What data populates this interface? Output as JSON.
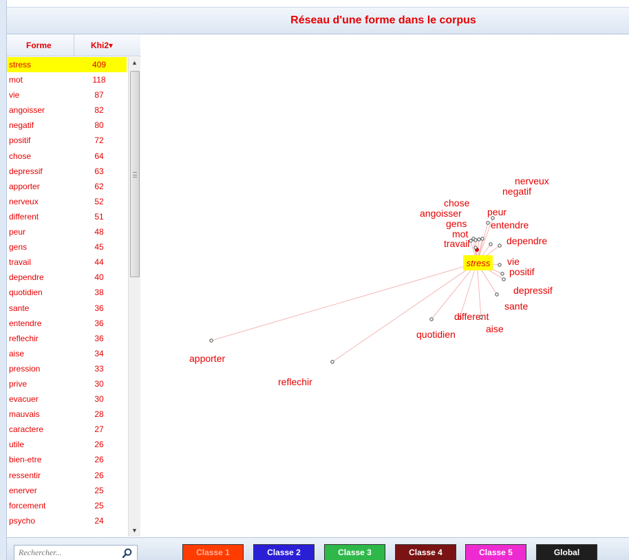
{
  "title": "Réseau d'une forme dans le corpus",
  "list": {
    "col_forme": "Forme",
    "col_khi": "Khi2",
    "sort_arrow": "▾",
    "rows": [
      {
        "forme": "stress",
        "khi": "409",
        "selected": true
      },
      {
        "forme": "mot",
        "khi": "118"
      },
      {
        "forme": "vie",
        "khi": "87"
      },
      {
        "forme": "angoisser",
        "khi": "82"
      },
      {
        "forme": "negatif",
        "khi": "80"
      },
      {
        "forme": "positif",
        "khi": "72"
      },
      {
        "forme": "chose",
        "khi": "64"
      },
      {
        "forme": "depressif",
        "khi": "63"
      },
      {
        "forme": "apporter",
        "khi": "62"
      },
      {
        "forme": "nerveux",
        "khi": "52"
      },
      {
        "forme": "different",
        "khi": "51"
      },
      {
        "forme": "peur",
        "khi": "48"
      },
      {
        "forme": "gens",
        "khi": "45"
      },
      {
        "forme": "travail",
        "khi": "44"
      },
      {
        "forme": "dependre",
        "khi": "40"
      },
      {
        "forme": "quotidien",
        "khi": "38"
      },
      {
        "forme": "sante",
        "khi": "36"
      },
      {
        "forme": "entendre",
        "khi": "36"
      },
      {
        "forme": "reflechir",
        "khi": "36"
      },
      {
        "forme": "aise",
        "khi": "34"
      },
      {
        "forme": "pression",
        "khi": "33"
      },
      {
        "forme": "prive",
        "khi": "30"
      },
      {
        "forme": "evacuer",
        "khi": "30"
      },
      {
        "forme": "mauvais",
        "khi": "28"
      },
      {
        "forme": "caractere",
        "khi": "27"
      },
      {
        "forme": "utile",
        "khi": "26"
      },
      {
        "forme": "bien-etre",
        "khi": "26"
      },
      {
        "forme": "ressentir",
        "khi": "26"
      },
      {
        "forme": "enerver",
        "khi": "25"
      },
      {
        "forme": "forcement",
        "khi": "25"
      },
      {
        "forme": "psycho",
        "khi": "24"
      }
    ]
  },
  "search": {
    "placeholder": "Rechercher...",
    "icon": "search-icon"
  },
  "buttons": [
    {
      "label": "Classe 1",
      "color": "#ff3c00",
      "text_color": "#ffb3a0"
    },
    {
      "label": "Classe 2",
      "color": "#2b1fd6",
      "text_color": "#ffffff"
    },
    {
      "label": "Classe 3",
      "color": "#2fb84a",
      "text_color": "#ffffff"
    },
    {
      "label": "Classe 4",
      "color": "#7a1414",
      "text_color": "#ffffff"
    },
    {
      "label": "Classe 5",
      "color": "#ee2bd0",
      "text_color": "#ffffff"
    },
    {
      "label": "Global",
      "color": "#1e1e1e",
      "text_color": "#ffffff"
    }
  ],
  "network": {
    "center": "stress",
    "accent": "#e60000",
    "highlight": "#ffff00",
    "nodes": [
      "nerveux",
      "negatif",
      "chose",
      "peur",
      "angoisser",
      "gens",
      "entendre",
      "mot",
      "dependre",
      "travail",
      "vie",
      "positif",
      "depressif",
      "sante",
      "different",
      "aise",
      "quotidien",
      "apporter",
      "reflechir"
    ]
  }
}
